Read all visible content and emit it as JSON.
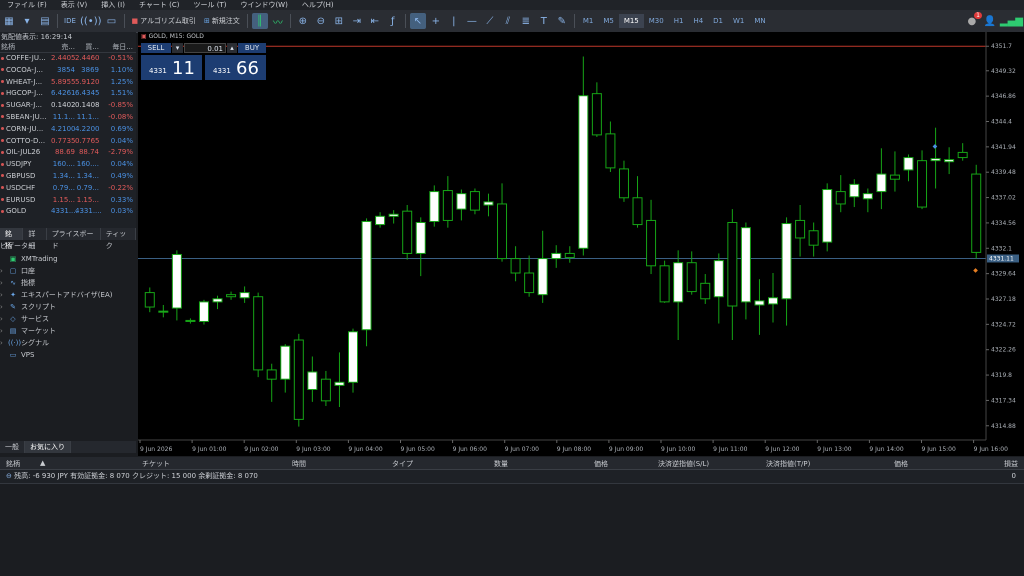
{
  "menu": [
    "ファイル (F)",
    "表示 (V)",
    "挿入 (I)",
    "チャート (C)",
    "ツール (T)",
    "ウインドウ(W)",
    "ヘルプ(H)"
  ],
  "toolbar": {
    "algo_label": "アルゴリズム取引",
    "new_order_label": "新規注文",
    "timeframes": [
      "M1",
      "M5",
      "M15",
      "M30",
      "H1",
      "H4",
      "D1",
      "W1",
      "MN"
    ],
    "active_timeframe": "M15",
    "notification_count": "1"
  },
  "market_watch": {
    "title": "気配値表示: 16:29:14",
    "headers": [
      "銘柄",
      "売...",
      "買...",
      "毎日..."
    ],
    "rows": [
      {
        "symbol": "COFFE-JU...",
        "bid": "2.4405",
        "ask": "2.4460",
        "change": "-0.51%",
        "dir": "dn"
      },
      {
        "symbol": "COCOA-J...",
        "bid": "3854",
        "ask": "3869",
        "change": "1.10%",
        "dir": "up"
      },
      {
        "symbol": "WHEAT-J...",
        "bid": "5.8955",
        "ask": "5.9120",
        "change": "1.25%",
        "dir": "dn"
      },
      {
        "symbol": "HGCOP-J...",
        "bid": "6.4261",
        "ask": "6.4345",
        "change": "1.51%",
        "dir": "up"
      },
      {
        "symbol": "SUGAR-J...",
        "bid": "0.1402",
        "ask": "0.1408",
        "change": "-0.85%",
        "dir": "neutral"
      },
      {
        "symbol": "SBEAN-JU...",
        "bid": "11.1...",
        "ask": "11.1...",
        "change": "-0.08%",
        "dir": "up"
      },
      {
        "symbol": "CORN-JU...",
        "bid": "4.2100",
        "ask": "4.2200",
        "change": "0.69%",
        "dir": "up"
      },
      {
        "symbol": "COTTO-D...",
        "bid": "0.7735",
        "ask": "0.7765",
        "change": "0.04%",
        "dir": "dn"
      },
      {
        "symbol": "OIL-JUL26",
        "bid": "88.69",
        "ask": "88.74",
        "change": "-2.79%",
        "dir": "dn"
      },
      {
        "symbol": "USDJPY",
        "bid": "160....",
        "ask": "160....",
        "change": "0.04%",
        "dir": "up"
      },
      {
        "symbol": "GBPUSD",
        "bid": "1.34...",
        "ask": "1.34...",
        "change": "0.49%",
        "dir": "up"
      },
      {
        "symbol": "USDCHF",
        "bid": "0.79...",
        "ask": "0.79...",
        "change": "-0.22%",
        "dir": "up"
      },
      {
        "symbol": "EURUSD",
        "bid": "1.15...",
        "ask": "1.15...",
        "change": "0.33%",
        "dir": "dn"
      },
      {
        "symbol": "GOLD",
        "bid": "4331....",
        "ask": "4331....",
        "change": "0.03%",
        "dir": "up"
      }
    ],
    "tabs": [
      "銘柄",
      "詳細",
      "プライスボード",
      "ティック"
    ]
  },
  "navigator": {
    "title": "ビゲーター",
    "items": [
      "XMTrading",
      "口座",
      "指標",
      "エキスパートアドバイザ(EA)",
      "スクリプト",
      "サービス",
      "マーケット",
      "シグナル",
      "VPS"
    ],
    "tabs": [
      "一般",
      "お気に入り"
    ]
  },
  "chart": {
    "title": "GOLD, M15: GOLD",
    "sell_label": "SELL",
    "buy_label": "BUY",
    "lot": "0.01",
    "sell_small": "4331",
    "sell_big": "11",
    "buy_small": "4331",
    "buy_big": "66"
  },
  "chart_data": {
    "type": "candlestick",
    "symbol": "GOLD",
    "timeframe": "M15",
    "y_ticks": [
      4351.7,
      4349.32,
      4346.86,
      4344.4,
      4341.94,
      4339.48,
      4337.02,
      4334.56,
      4332.1,
      4329.64,
      4327.18,
      4324.72,
      4322.26,
      4319.8,
      4317.34,
      4314.88
    ],
    "current_price_label": "4331.11",
    "x_labels": [
      "9 Jun 2026",
      "9 Jun 01:00",
      "9 Jun 02:00",
      "9 Jun 03:00",
      "9 Jun 04:00",
      "9 Jun 05:00",
      "9 Jun 06:00",
      "9 Jun 07:00",
      "9 Jun 08:00",
      "9 Jun 09:00",
      "9 Jun 10:00",
      "9 Jun 11:00",
      "9 Jun 12:00",
      "9 Jun 13:00",
      "9 Jun 14:00",
      "9 Jun 15:00",
      "9 Jun 16:00"
    ],
    "ylim": [
      4313.5,
      4352.5
    ],
    "current_price": 4331.11,
    "top_line": 4351.7,
    "candles": [
      [
        4327.8,
        4328.3,
        4325.9,
        4326.4
      ],
      [
        4325.9,
        4326.6,
        4325.4,
        4326.0
      ],
      [
        4326.3,
        4331.9,
        4325.1,
        4331.5
      ],
      [
        4325.1,
        4325.3,
        4324.8,
        4325.0
      ],
      [
        4325.0,
        4327.1,
        4324.7,
        4326.9
      ],
      [
        4326.9,
        4327.5,
        4326.2,
        4327.2
      ],
      [
        4327.6,
        4327.9,
        4327.1,
        4327.4
      ],
      [
        4327.3,
        4328.4,
        4326.8,
        4327.8
      ],
      [
        4327.4,
        4327.8,
        4319.6,
        4320.3
      ],
      [
        4320.3,
        4320.9,
        4317.2,
        4319.4
      ],
      [
        4319.4,
        4322.8,
        4318.1,
        4322.6
      ],
      [
        4323.2,
        4323.8,
        4314.8,
        4315.5
      ],
      [
        4318.4,
        4321.6,
        4317.2,
        4320.1
      ],
      [
        4319.4,
        4320.2,
        4316.8,
        4317.3
      ],
      [
        4318.8,
        4322.0,
        4316.7,
        4319.1
      ],
      [
        4319.1,
        4324.3,
        4318.1,
        4324.0
      ],
      [
        4324.2,
        4335.0,
        4322.6,
        4334.7
      ],
      [
        4334.4,
        4335.6,
        4334.1,
        4335.2
      ],
      [
        4335.2,
        4335.8,
        4334.5,
        4335.4
      ],
      [
        4335.7,
        4336.3,
        4331.0,
        4331.6
      ],
      [
        4331.6,
        4335.1,
        4329.4,
        4334.6
      ],
      [
        4334.7,
        4338.2,
        4334.2,
        4337.6
      ],
      [
        4337.7,
        4339.1,
        4334.1,
        4334.8
      ],
      [
        4335.9,
        4337.8,
        4334.8,
        4337.4
      ],
      [
        4337.6,
        4337.9,
        4335.4,
        4335.8
      ],
      [
        4336.3,
        4337.4,
        4335.2,
        4336.6
      ],
      [
        4336.4,
        4338.4,
        4330.8,
        4331.1
      ],
      [
        4331.1,
        4332.3,
        4328.9,
        4329.7
      ],
      [
        4329.7,
        4331.4,
        4327.4,
        4327.8
      ],
      [
        4327.6,
        4333.8,
        4326.8,
        4331.1
      ],
      [
        4331.1,
        4332.4,
        4330.2,
        4331.6
      ],
      [
        4331.6,
        4332.3,
        4330.7,
        4331.2
      ],
      [
        4332.1,
        4350.7,
        4331.4,
        4346.9
      ],
      [
        4347.1,
        4348.2,
        4342.9,
        4343.1
      ],
      [
        4343.2,
        4344.4,
        4339.5,
        4339.9
      ],
      [
        4339.8,
        4340.6,
        4336.6,
        4337.0
      ],
      [
        4337.0,
        4339.1,
        4334.1,
        4334.4
      ],
      [
        4334.8,
        4336.8,
        4329.6,
        4330.4
      ],
      [
        4330.4,
        4330.9,
        4326.8,
        4326.9
      ],
      [
        4326.9,
        4331.9,
        4323.2,
        4330.7
      ],
      [
        4330.7,
        4331.8,
        4327.6,
        4327.9
      ],
      [
        4328.7,
        4329.6,
        4326.7,
        4327.2
      ],
      [
        4327.4,
        4331.6,
        4324.8,
        4330.9
      ],
      [
        4334.6,
        4335.9,
        4323.2,
        4326.5
      ],
      [
        4326.9,
        4334.6,
        4325.2,
        4334.1
      ],
      [
        4326.6,
        4329.1,
        4323.7,
        4327.0
      ],
      [
        4326.7,
        4329.7,
        4324.9,
        4327.3
      ],
      [
        4327.2,
        4335.1,
        4324.6,
        4334.5
      ],
      [
        4334.8,
        4336.3,
        4331.3,
        4333.1
      ],
      [
        4333.8,
        4334.6,
        4331.3,
        4332.4
      ],
      [
        4332.7,
        4338.4,
        4331.8,
        4337.8
      ],
      [
        4337.6,
        4339.2,
        4335.6,
        4336.4
      ],
      [
        4337.1,
        4338.8,
        4336.1,
        4338.3
      ],
      [
        4336.9,
        4337.9,
        4335.6,
        4337.4
      ],
      [
        4337.6,
        4341.8,
        4335.9,
        4339.3
      ],
      [
        4339.2,
        4341.5,
        4337.6,
        4338.8
      ],
      [
        4339.7,
        4341.2,
        4338.6,
        4340.9
      ],
      [
        4340.6,
        4341.6,
        4335.9,
        4336.1
      ],
      [
        4340.6,
        4343.8,
        4337.9,
        4340.8
      ],
      [
        4340.5,
        4341.9,
        4339.3,
        4340.7
      ],
      [
        4341.4,
        4342.3,
        4340.6,
        4340.9
      ],
      [
        4339.3,
        4340.2,
        4331.1,
        4331.7
      ]
    ]
  },
  "terminal": {
    "headers": [
      "銘柄",
      "チケット",
      "時間",
      "タイプ",
      "数量",
      "価格",
      "決済逆指値(S/L)",
      "決済指値(T/P)",
      "価格",
      "損益"
    ],
    "balance": "残高: -6 930 JPY  有効証拠金: 8 070  クレジット: 15 000  余剰証拠金: 8 070",
    "pnl": "0"
  },
  "colors": {
    "bull_fill": "#ffffff",
    "candle_line": "#16a516",
    "current_price_line": "#3a5f83",
    "top_line": "#c0392b",
    "accent": "#1d3d72"
  }
}
